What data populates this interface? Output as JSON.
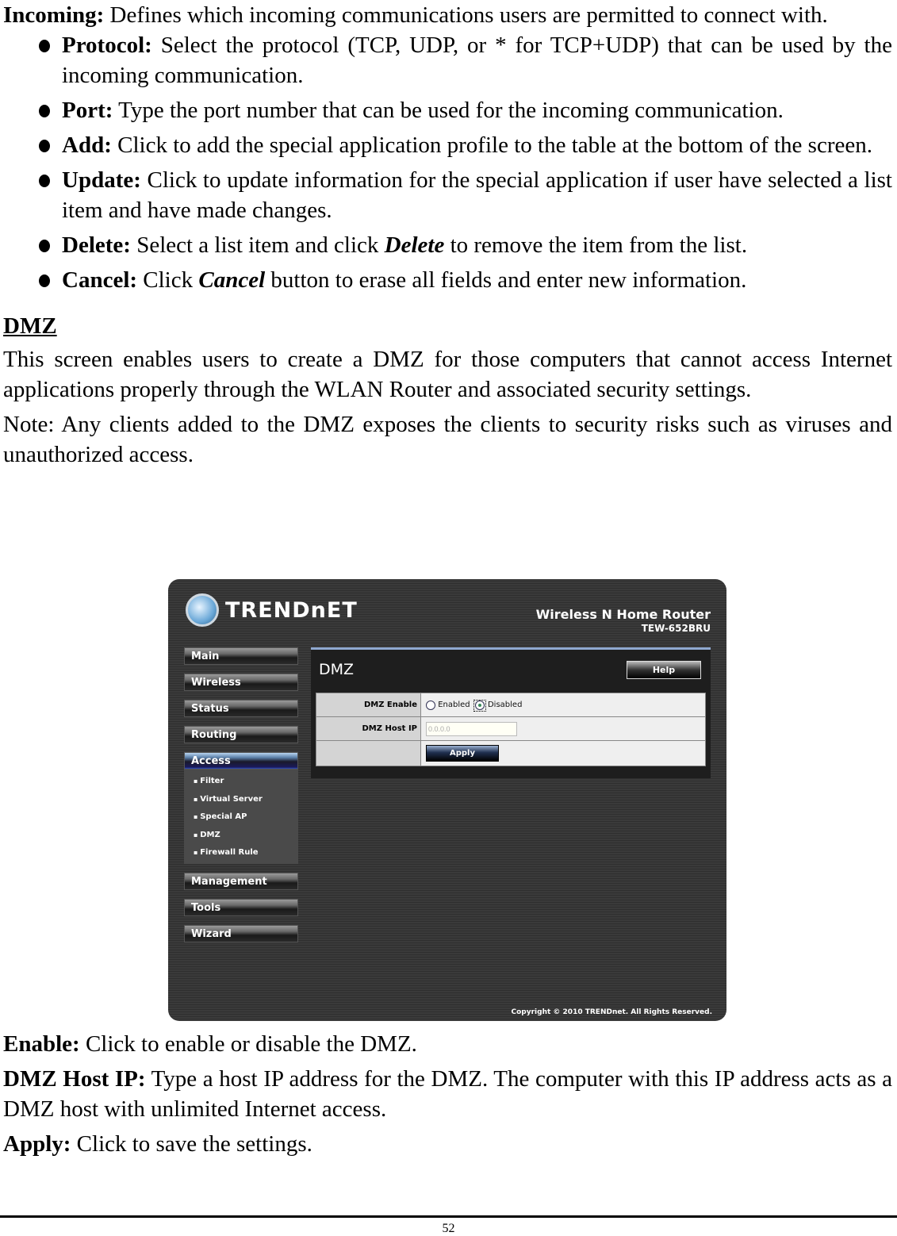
{
  "doc": {
    "incoming": {
      "term": "Incoming:",
      "text": " Defines which incoming communications users are permitted to connect with."
    },
    "bullets": [
      {
        "term": "Protocol:",
        "text": " Select the protocol (TCP, UDP, or * for TCP+UDP) that can be used by the incoming communication."
      },
      {
        "term": "Port:",
        "text": " Type the port number that can be used for the incoming communication."
      },
      {
        "term": "Add:",
        "text": " Click to add the special application profile to the table at the bottom of the screen."
      },
      {
        "term": "Update:",
        "text": " Click to update information for the special application if user have selected a list item and have made changes."
      },
      {
        "term": "Delete:",
        "text": " Select a list item and click ",
        "em": "Delete",
        "after": " to remove the item from the list."
      },
      {
        "term": "Cancel:",
        "text": " Click ",
        "em": "Cancel",
        "after": " button to erase all fields and enter new information."
      }
    ],
    "section_heading": "DMZ",
    "intro": "This screen enables users to create a DMZ for those computers that cannot access Internet applications properly through the WLAN Router and associated security settings.",
    "note": "Note: Any clients added to the DMZ exposes the clients to security risks such as viruses and unauthorized access.",
    "after": [
      {
        "term": "Enable:",
        "text": " Click to enable or disable the DMZ."
      },
      {
        "term": "DMZ Host IP:",
        "text": " Type a host IP address for the DMZ. The computer with this IP address acts as a DMZ host with unlimited Internet access."
      },
      {
        "term": "Apply:",
        "text": " Click to save the settings."
      }
    ],
    "page_number": "52"
  },
  "router": {
    "brand": "TRENDnET",
    "product_name": "Wireless N Home Router",
    "model": "TEW-652BRU",
    "nav": [
      "Main",
      "Wireless",
      "Status",
      "Routing",
      "Access",
      "Management",
      "Tools",
      "Wizard"
    ],
    "active_nav": "Access",
    "subnav": [
      "Filter",
      "Virtual Server",
      "Special AP",
      "DMZ",
      "Firewall Rule"
    ],
    "panel_title": "DMZ",
    "help_label": "Help",
    "fields": {
      "enable_label": "DMZ Enable",
      "enabled_option": "Enabled",
      "disabled_option": "Disabled",
      "selected": "Disabled",
      "host_ip_label": "DMZ Host IP",
      "host_ip_value": "0.0.0.0"
    },
    "apply_label": "Apply",
    "copyright": "Copyright © 2010 TRENDnet. All Rights Reserved."
  }
}
